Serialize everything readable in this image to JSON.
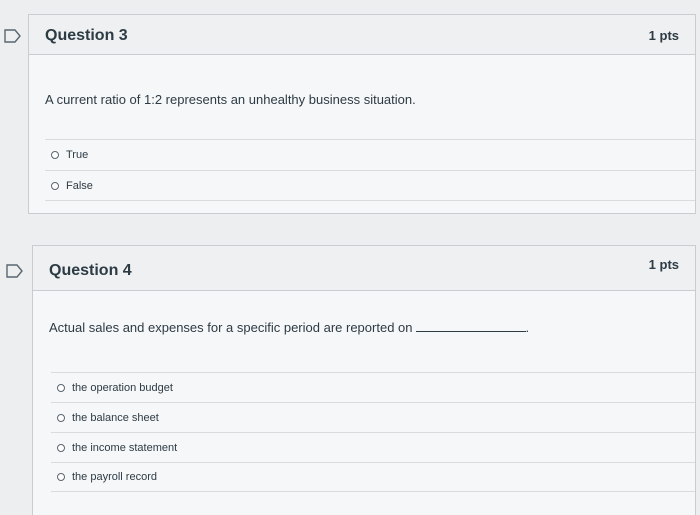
{
  "questions": [
    {
      "title": "Question 3",
      "points": "1 pts",
      "text": "A current ratio of 1:2 represents an unhealthy business situation.",
      "blank_suffix": "",
      "answers": [
        "True",
        "False"
      ]
    },
    {
      "title": "Question 4",
      "points": "1 pts",
      "text": "Actual sales and expenses for a specific period are reported on",
      "blank_suffix": ".",
      "answers": [
        "the operation budget",
        "the balance sheet",
        "the income statement",
        "the payroll record"
      ]
    }
  ],
  "icons": {
    "flag": "flag-question-icon",
    "radio": "radio-button-icon"
  },
  "colors": {
    "background": "#eceef0",
    "card": "#f6f7f8",
    "header": "#eef0f1",
    "border": "#c7cdd1",
    "text": "#2d3b45"
  }
}
